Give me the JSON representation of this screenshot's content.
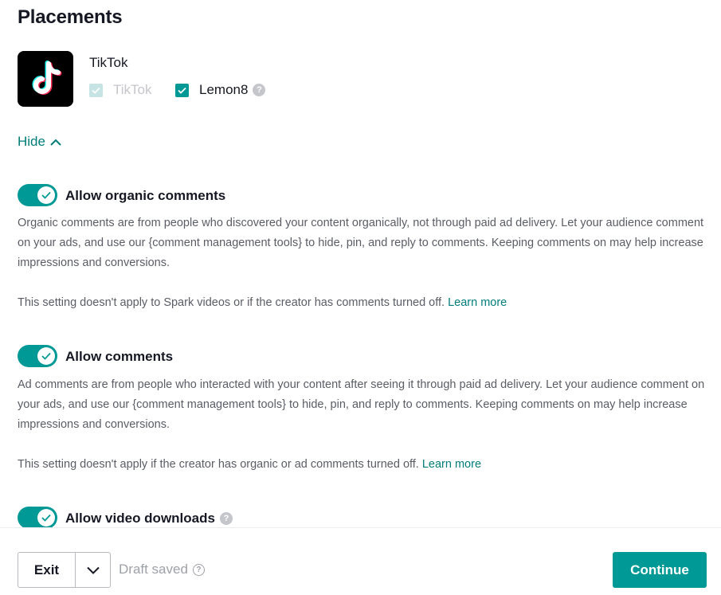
{
  "page": {
    "title": "Placements"
  },
  "platform": {
    "name": "TikTok",
    "logo_icon": "tiktok-logo",
    "checkboxes": [
      {
        "label": "TikTok",
        "checked": true,
        "disabled": true
      },
      {
        "label": "Lemon8",
        "checked": true,
        "disabled": false,
        "help_icon": "?"
      }
    ]
  },
  "hide_link": {
    "label": "Hide",
    "icon": "chevron-up-icon"
  },
  "settings": [
    {
      "label": "Allow organic comments",
      "enabled": true,
      "description": "Organic comments are from people who discovered your content organically, not through paid ad delivery. Let your audience comment on your ads, and use our {comment management tools} to hide, pin, and reply to comments. Keeping comments on may help increase impressions and conversions.",
      "note": "This setting doesn't apply to Spark videos or if the creator has comments turned off.",
      "link": "Learn more"
    },
    {
      "label": "Allow comments",
      "enabled": true,
      "description": "Ad comments are from people who interacted with your content after seeing it through paid ad delivery. Let your audience comment on your ads, and use our {comment management tools} to hide, pin, and reply to comments. Keeping comments on may help increase impressions and conversions.",
      "note": "This setting doesn't apply if the creator has organic or ad comments turned off.",
      "link": "Learn more"
    },
    {
      "label": "Allow video downloads",
      "enabled": true,
      "help_icon": "?"
    }
  ],
  "footer": {
    "exit_label": "Exit",
    "draft_status": "Draft saved",
    "draft_help_icon": "?",
    "continue_label": "Continue"
  },
  "colors": {
    "accent": "#009995",
    "link": "#007d7a",
    "text": "#161823",
    "muted": "#5b5d66"
  }
}
